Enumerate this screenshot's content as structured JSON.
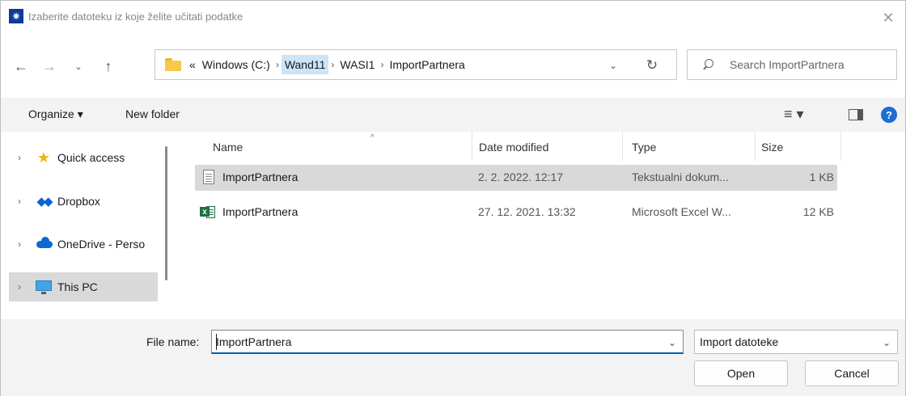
{
  "window": {
    "title": "Izaberite datoteku iz koje želite učitati podatke",
    "app_icon": "app-star-icon",
    "close_glyph": "✕"
  },
  "nav": {
    "back_glyph": "←",
    "forward_glyph": "→",
    "recent_glyph": "⌄",
    "up_glyph": "↑",
    "breadcrumbs": [
      {
        "label": "«"
      },
      {
        "label": "Windows (C:)"
      },
      {
        "label": "Wand11"
      },
      {
        "label": "WASI1"
      },
      {
        "label": "ImportPartnera"
      }
    ],
    "separator": "›",
    "dropdown_glyph": "⌄",
    "refresh_glyph": "↻",
    "search_placeholder": "Search ImportPartnera"
  },
  "toolbar": {
    "organize_label": "Organize ▾",
    "new_folder_label": "New folder",
    "view_glyph": "≡ ▾",
    "help_glyph": "?"
  },
  "sidebar": {
    "items": [
      {
        "label": "Quick access",
        "icon": "star-icon"
      },
      {
        "label": "Dropbox",
        "icon": "dropbox-icon"
      },
      {
        "label": "OneDrive - Perso",
        "icon": "onedrive-icon"
      },
      {
        "label": "This PC",
        "icon": "this-pc-icon",
        "selected": true
      }
    ],
    "chevron": "›"
  },
  "filelist": {
    "columns": {
      "name": "Name",
      "date": "Date modified",
      "type": "Type",
      "size": "Size"
    },
    "sort_glyph": "^",
    "rows": [
      {
        "name": "ImportPartnera",
        "date": "2. 2. 2022. 12:17",
        "type": "Tekstualni dokum...",
        "size": "1 KB",
        "icon": "text-file-icon",
        "selected": true
      },
      {
        "name": "ImportPartnera",
        "date": "27. 12. 2021. 13:32",
        "type": "Microsoft Excel W...",
        "size": "12 KB",
        "icon": "excel-file-icon",
        "selected": false
      }
    ]
  },
  "bottom": {
    "file_name_label": "File name:",
    "file_name_value": "ImportPartnera",
    "file_type_value": "Import datoteke",
    "dropdown_glyph": "⌄",
    "open_label": "Open",
    "cancel_label": "Cancel"
  }
}
